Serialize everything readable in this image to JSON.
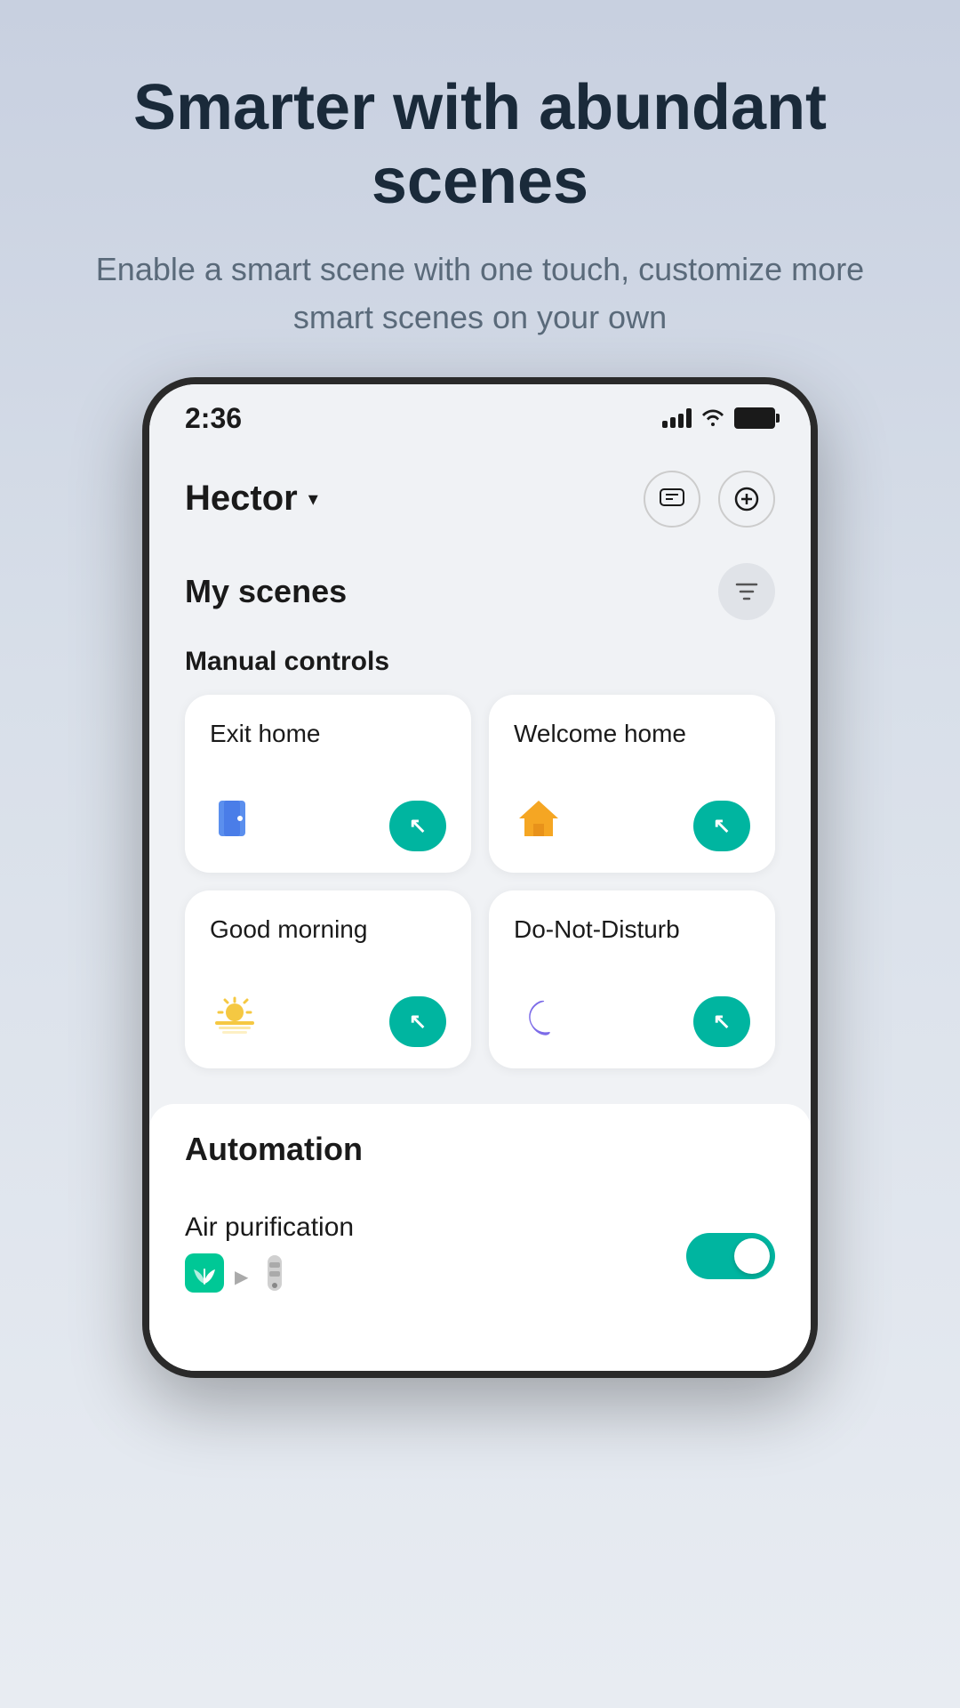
{
  "promo": {
    "title": "Smarter with abundant scenes",
    "subtitle": "Enable a smart scene with one touch, customize more smart scenes on your own"
  },
  "statusBar": {
    "time": "2:36",
    "signal": "full",
    "wifi": "on",
    "battery": "full"
  },
  "topNav": {
    "homeName": "Hector",
    "chevron": "▾",
    "messageIcon": "message",
    "addIcon": "add"
  },
  "myScenes": {
    "title": "My scenes",
    "filterIcon": "filter"
  },
  "manualControls": {
    "label": "Manual controls",
    "scenes": [
      {
        "id": "exit-home",
        "title": "Exit home",
        "icon": "🟦",
        "iconType": "door"
      },
      {
        "id": "welcome-home",
        "title": "Welcome home",
        "icon": "🏠",
        "iconType": "house"
      },
      {
        "id": "good-morning",
        "title": "Good morning",
        "icon": "🌅",
        "iconType": "sunrise"
      },
      {
        "id": "do-not-disturb",
        "title": "Do-Not-Disturb",
        "icon": "🌙",
        "iconType": "moon"
      }
    ],
    "runBtnArrow": "↖"
  },
  "automation": {
    "title": "Automation",
    "items": [
      {
        "id": "air-purification",
        "name": "Air purification",
        "toggled": true,
        "sourceIcon": "🌿",
        "arrowText": "▶",
        "deviceIcon": "🫙"
      }
    ]
  }
}
